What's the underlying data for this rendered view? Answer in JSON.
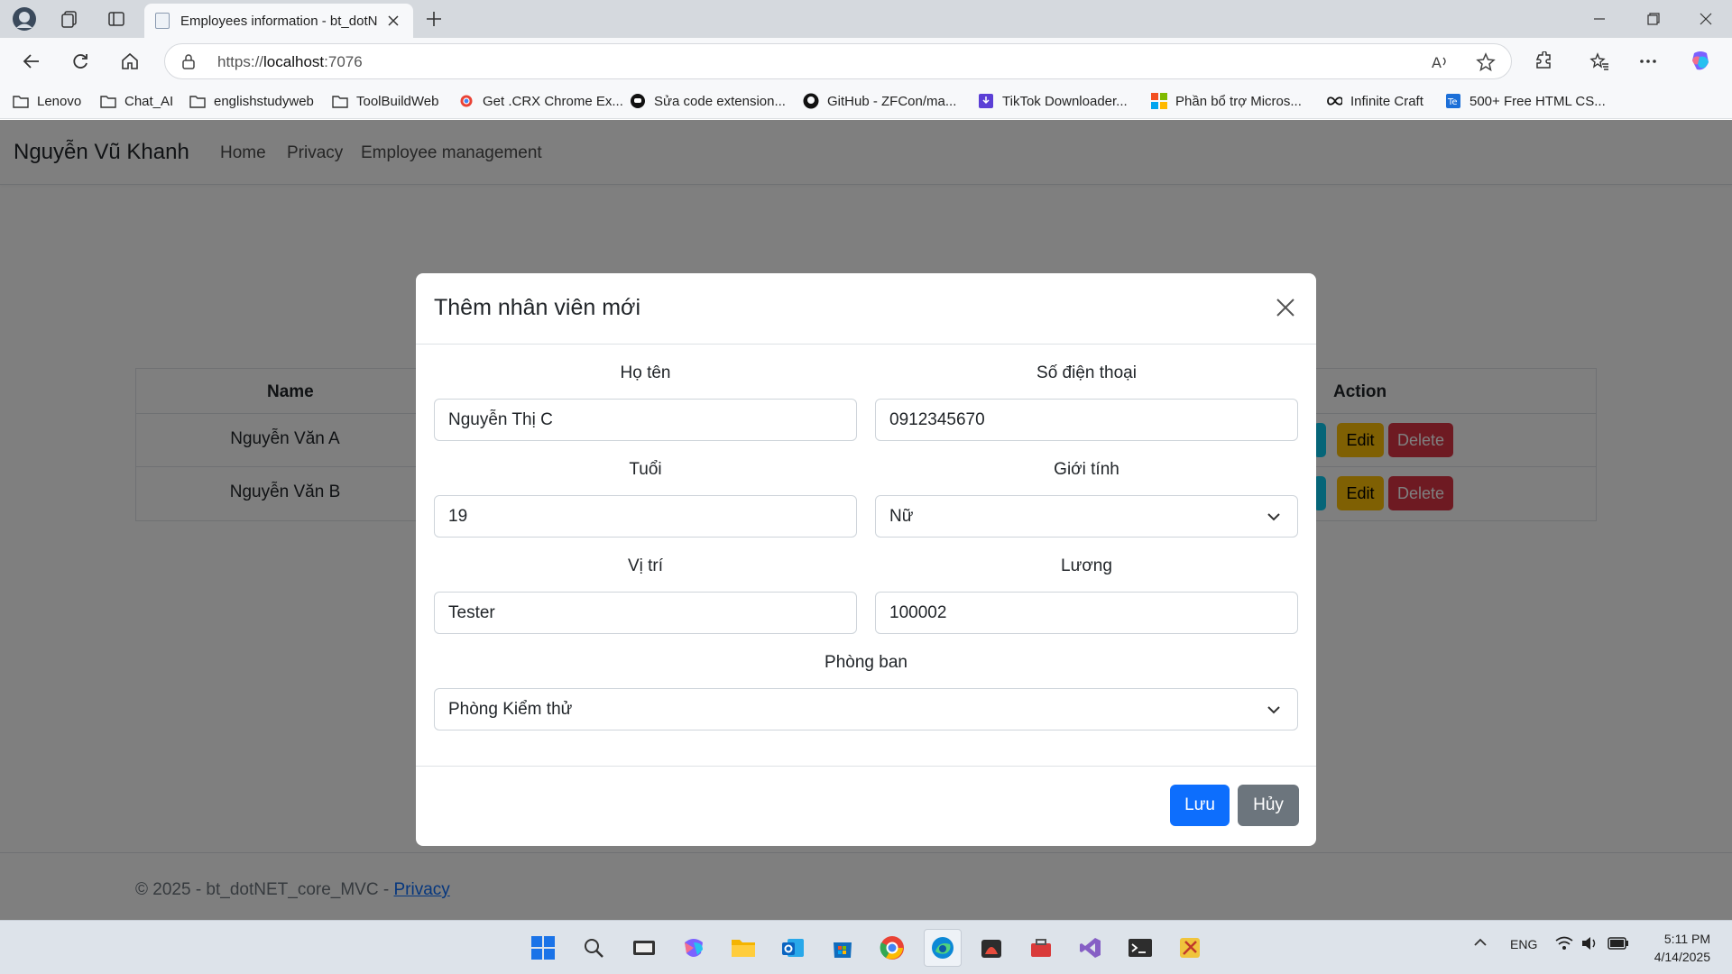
{
  "browser": {
    "tab_title": "Employees information - bt_dotN",
    "url_prefix": "https://",
    "url_host": "localhost",
    "url_port": ":7076",
    "bookmarks": [
      "Lenovo",
      "Chat_AI",
      "englishstudyweb",
      "ToolBuildWeb",
      "Get .CRX Chrome Ex...",
      "Sửa code extension...",
      "GitHub - ZFCon/ma...",
      "TikTok Downloader...",
      "Phần bổ trợ Micros...",
      "Infinite Craft",
      "500+ Free HTML CS..."
    ]
  },
  "site": {
    "brand": "Nguyễn Vũ Khanh",
    "nav": [
      "Home",
      "Privacy",
      "Employee management"
    ]
  },
  "table": {
    "headers": {
      "name": "Name",
      "action": "Action"
    },
    "rows": [
      {
        "name": "Nguyễn Văn A"
      },
      {
        "name": "Nguyễn Văn B"
      }
    ],
    "buttons": {
      "edit": "Edit",
      "delete": "Delete"
    }
  },
  "footer": {
    "text": "© 2025 - bt_dotNET_core_MVC - ",
    "link": "Privacy"
  },
  "modal": {
    "title": "Thêm nhân viên mới",
    "fields": {
      "name": {
        "label": "Họ tên",
        "value": "Nguyễn Thị C"
      },
      "phone": {
        "label": "Số điện thoại",
        "value": "0912345670"
      },
      "age": {
        "label": "Tuổi",
        "value": "19"
      },
      "gender": {
        "label": "Giới tính",
        "value": "Nữ"
      },
      "position": {
        "label": "Vị trí",
        "value": "Tester"
      },
      "salary": {
        "label": "Lương",
        "value": "100002"
      },
      "department": {
        "label": "Phòng ban",
        "value": "Phòng Kiểm thử"
      }
    },
    "save": "Lưu",
    "cancel": "Hủy"
  },
  "taskbar": {
    "lang": "ENG",
    "time": "5:11 PM",
    "date": "4/14/2025"
  },
  "colors": {
    "primary": "#0d6efd",
    "secondary": "#6c757d",
    "warning": "#ffc107",
    "danger": "#dc3545",
    "info": "#0dcaf0"
  }
}
